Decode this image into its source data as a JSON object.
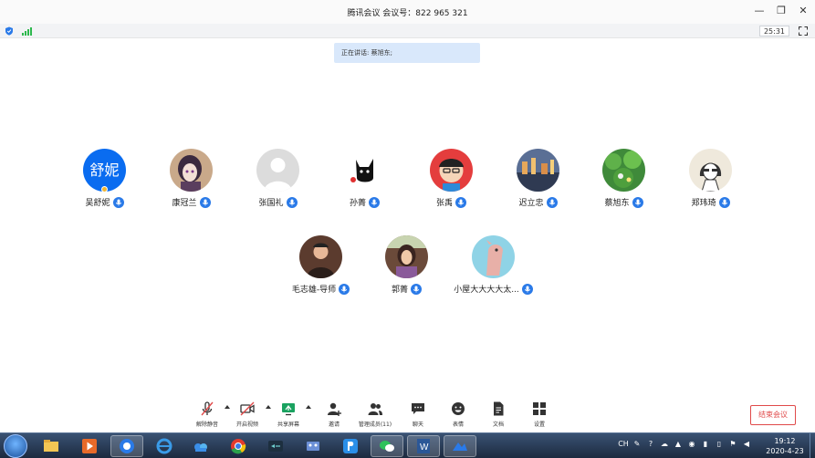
{
  "window": {
    "title": "腾讯会议 会议号：822 965 321"
  },
  "status": {
    "timer": "25:31"
  },
  "toast": {
    "text": "正在讲话: 蔡旭东;"
  },
  "participants": [
    {
      "name": "吴舒妮",
      "avatar_text": "舒妮",
      "avatar_color": "#0a6cf0",
      "host": true
    },
    {
      "name": "康冠兰",
      "avatar_text": "",
      "avatar_color": "#c9a98a"
    },
    {
      "name": "张国礼",
      "avatar_text": "",
      "avatar_color": "#dcdcdc"
    },
    {
      "name": "孙菁",
      "avatar_text": "",
      "avatar_color": "#ffffff"
    },
    {
      "name": "张禹",
      "avatar_text": "",
      "avatar_color": "#e43d3d"
    },
    {
      "name": "迟立忠",
      "avatar_text": "",
      "avatar_color": "#5a6f95"
    },
    {
      "name": "蔡旭东",
      "avatar_text": "",
      "avatar_color": "#3f8a3a"
    },
    {
      "name": "郑玮琦",
      "avatar_text": "",
      "avatar_color": "#efe9dc"
    },
    {
      "name": "毛志雄-导师",
      "avatar_text": "",
      "avatar_color": "#5b3b2e"
    },
    {
      "name": "郭菁",
      "avatar_text": "",
      "avatar_color": "#6b4a3a"
    },
    {
      "name": "小屋大大大大太...",
      "avatar_text": "",
      "avatar_color": "#8fd3e6"
    }
  ],
  "toolbar": {
    "unmute": "解除静音",
    "video": "开启视频",
    "share": "共享屏幕",
    "invite": "邀请",
    "manage": "管理成员(11)",
    "chat": "聊天",
    "emoji": "表情",
    "docs": "文档",
    "settings": "设置",
    "end": "结束会议"
  },
  "taskbar": {
    "apps": [
      "file-explorer-icon",
      "media-player-icon",
      "tencent-meeting-icon",
      "ie-browser-icon",
      "baidu-netdisk-icon",
      "chrome-icon",
      "xshell-icon",
      "video-editor-icon",
      "pp-app-icon",
      "wechat-icon",
      "word-icon",
      "tencent-meeting-window-icon"
    ],
    "time": "19:12",
    "date": "2020-4-23"
  },
  "colors": {
    "accent": "#2a7ae8",
    "end_red": "#e04a4a",
    "toast_bg": "#d9e8fb"
  }
}
